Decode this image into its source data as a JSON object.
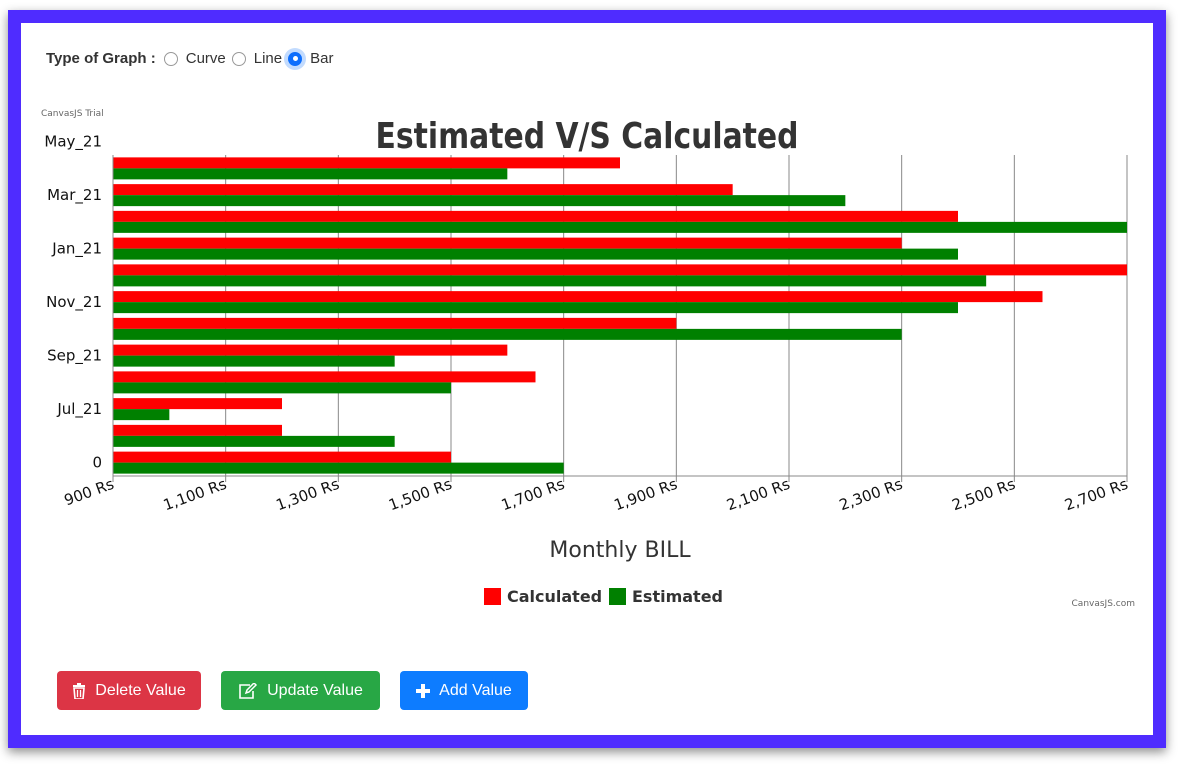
{
  "controls": {
    "label": "Type of Graph :",
    "options": [
      "Curve",
      "Line",
      "Bar"
    ],
    "selected": "Bar"
  },
  "watermarks": {
    "trial": "CanvasJS Trial",
    "credit": "CanvasJS.com"
  },
  "buttons": {
    "delete": "Delete Value",
    "update": "Update Value",
    "add": "Add Value"
  },
  "colors": {
    "calculated": "#ff0000",
    "estimated": "#008000",
    "frame": "#4f2cff",
    "delete": "#dc3545",
    "update": "#28a745",
    "add": "#0d7cff"
  },
  "chart_data": {
    "type": "bar",
    "orientation": "horizontal",
    "title": "Estimated V/S Calculated",
    "xlabel": "Monthly BILL",
    "ylabel": "",
    "xlim": [
      900,
      2700
    ],
    "x_ticks": [
      "900 Rs",
      "1,100 Rs",
      "1,300 Rs",
      "1,500 Rs",
      "1,700 Rs",
      "1,900 Rs",
      "2,100 Rs",
      "2,300 Rs",
      "2,500 Rs",
      "2,700 Rs"
    ],
    "y_tick_labels": [
      "0",
      "Jul_21",
      "Sep_21",
      "Nov_21",
      "Jan_21",
      "Mar_21",
      "May_21"
    ],
    "grid": "vertical",
    "legend": "bottom-center",
    "series": [
      {
        "name": "Calculated",
        "values": [
          1500,
          1200,
          1200,
          1650,
          1600,
          1900,
          2550,
          2700,
          2300,
          2400,
          2000,
          1800
        ]
      },
      {
        "name": "Estimated",
        "values": [
          1700,
          1400,
          1000,
          1500,
          1400,
          2300,
          2400,
          2450,
          2400,
          2700,
          2200,
          1600
        ]
      }
    ]
  }
}
